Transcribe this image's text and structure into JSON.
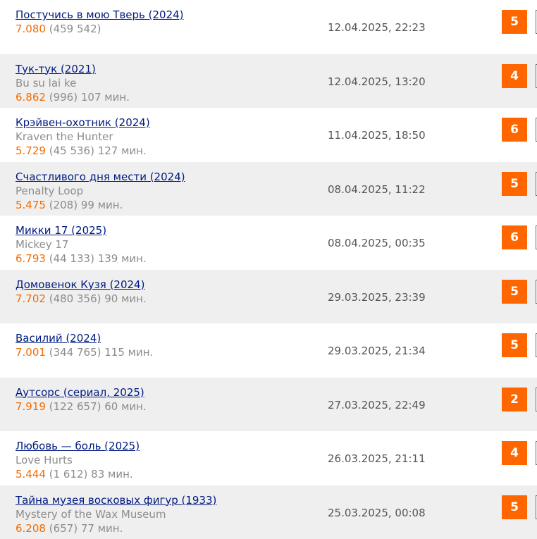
{
  "accent_color": "#ff6600",
  "movies": [
    {
      "title": "Постучись в мою Тверь (2024)",
      "original": "",
      "rating": "7.080",
      "votes": "(459 542)",
      "duration": "",
      "date": "12.04.2025, 22:23",
      "score": "5"
    },
    {
      "title": "Тук-тук (2021)",
      "original": "Bu su lai ke",
      "rating": "6.862",
      "votes": "(996)",
      "duration": "107 мин.",
      "date": "12.04.2025, 13:20",
      "score": "4"
    },
    {
      "title": "Крэйвен-охотник (2024)",
      "original": "Kraven the Hunter",
      "rating": "5.729",
      "votes": "(45 536)",
      "duration": "127 мин.",
      "date": "11.04.2025, 18:50",
      "score": "6"
    },
    {
      "title": "Счастливого дня мести (2024)",
      "original": "Penalty Loop",
      "rating": "5.475",
      "votes": "(208)",
      "duration": "99 мин.",
      "date": "08.04.2025, 11:22",
      "score": "5"
    },
    {
      "title": "Микки 17 (2025)",
      "original": "Mickey 17",
      "rating": "6.793",
      "votes": "(44 133)",
      "duration": "139 мин.",
      "date": "08.04.2025, 00:35",
      "score": "6"
    },
    {
      "title": "Домовенок Кузя (2024)",
      "original": "",
      "rating": "7.702",
      "votes": "(480 356)",
      "duration": "90 мин.",
      "date": "29.03.2025, 23:39",
      "score": "5"
    },
    {
      "title": "Василий (2024)",
      "original": "",
      "rating": "7.001",
      "votes": "(344 765)",
      "duration": "115 мин.",
      "date": "29.03.2025, 21:34",
      "score": "5"
    },
    {
      "title": "Аутсорс (сериал, 2025)",
      "original": "",
      "rating": "7.919",
      "votes": "(122 657)",
      "duration": "60 мин.",
      "date": "27.03.2025, 22:49",
      "score": "2"
    },
    {
      "title": "Любовь — боль (2025)",
      "original": "Love Hurts",
      "rating": "5.444",
      "votes": "(1 612)",
      "duration": "83 мин.",
      "date": "26.03.2025, 21:11",
      "score": "4"
    },
    {
      "title": "Тайна музея восковых фигур (1933)",
      "original": "Mystery of the Wax Museum",
      "rating": "6.208",
      "votes": "(657)",
      "duration": "77 мин.",
      "date": "25.03.2025, 00:08",
      "score": "5"
    }
  ]
}
